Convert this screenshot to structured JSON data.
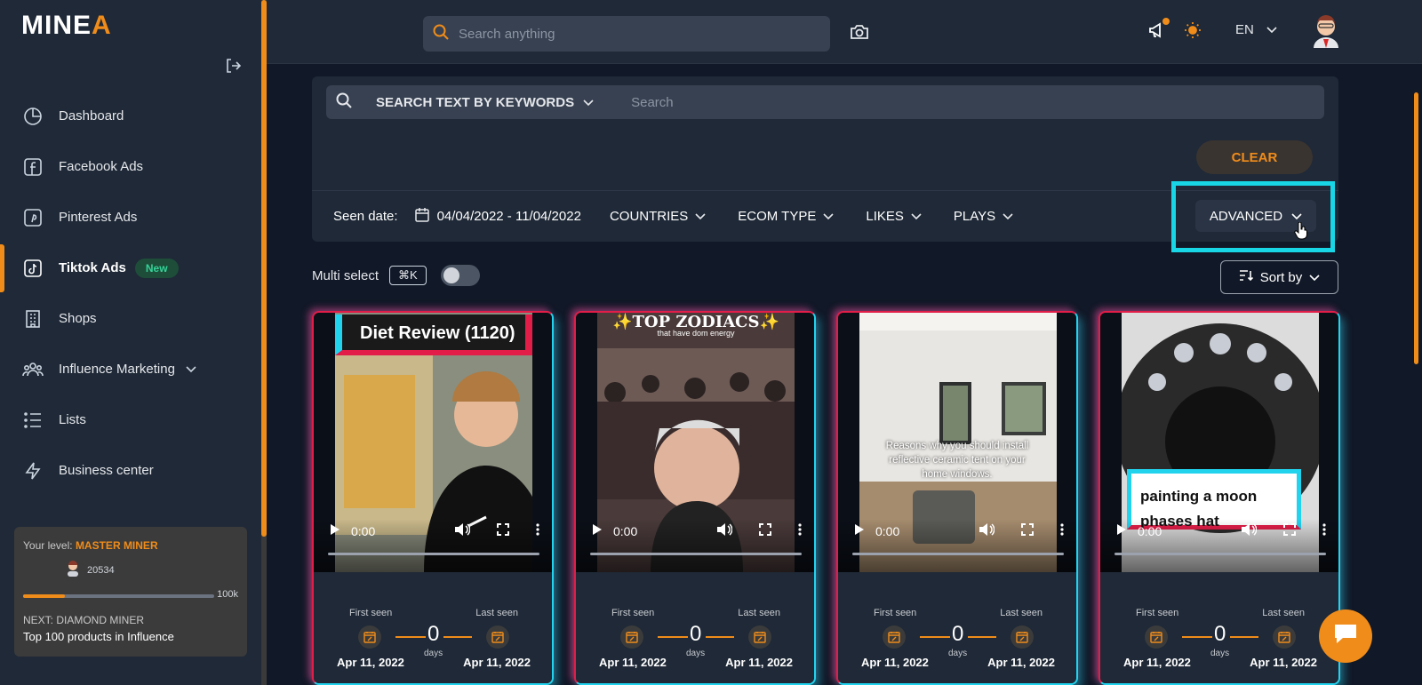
{
  "app": {
    "logo": "MINEA"
  },
  "sidebar": {
    "items": [
      {
        "label": "Dashboard",
        "icon": "dashboard-icon"
      },
      {
        "label": "Facebook Ads",
        "icon": "facebook-icon"
      },
      {
        "label": "Pinterest Ads",
        "icon": "pinterest-icon"
      },
      {
        "label": "Tiktok Ads",
        "icon": "tiktok-icon",
        "active": true,
        "badge": "New"
      },
      {
        "label": "Shops",
        "icon": "shop-icon"
      },
      {
        "label": "Influence Marketing",
        "icon": "users-icon"
      },
      {
        "label": "Lists",
        "icon": "list-icon"
      },
      {
        "label": "Business center",
        "icon": "bolt-icon"
      }
    ],
    "level": {
      "your_level_label": "Your level:",
      "your_level": "MASTER MINER",
      "points": "20534",
      "max": "100k",
      "progress_fraction": 0.22,
      "next_label": "NEXT: DIAMOND MINER",
      "next_text": "Top 100 products in Influence"
    }
  },
  "topbar": {
    "search_placeholder": "Search anything",
    "lang": "EN"
  },
  "filters": {
    "keyword_mode": "SEARCH TEXT BY KEYWORDS",
    "keyword_placeholder": "Search",
    "clear_label": "CLEAR",
    "seen_date_label": "Seen date:",
    "date_range": "04/04/2022 - 11/04/2022",
    "countries": "COUNTRIES",
    "ecom_type": "ECOM TYPE",
    "likes": "LIKES",
    "plays": "PLAYS",
    "advanced": "ADVANCED"
  },
  "toolbar": {
    "multi_select_label": "Multi select",
    "shortcut": "⌘K",
    "sort_label": "Sort by"
  },
  "cards": [
    {
      "caption": "Diet Review (1120)",
      "time": "0:00",
      "first_seen_label": "First seen",
      "last_seen_label": "Last seen",
      "days": "0",
      "days_label": "days",
      "first_date": "Apr 11, 2022",
      "last_date": "Apr 11, 2022"
    },
    {
      "caption": "✨TOP ZODIACS✨",
      "subcaption": "that have dom energy",
      "time": "0:00",
      "first_seen_label": "First seen",
      "last_seen_label": "Last seen",
      "days": "0",
      "days_label": "days",
      "first_date": "Apr 11, 2022",
      "last_date": "Apr 11, 2022"
    },
    {
      "caption": "Reasons why you should install reflective ceramic tent on your home windows.",
      "time": "0:00",
      "first_seen_label": "First seen",
      "last_seen_label": "Last seen",
      "days": "0",
      "days_label": "days",
      "first_date": "Apr 11, 2022",
      "last_date": "Apr 11, 2022"
    },
    {
      "caption": "painting a moon phases hat",
      "time": "0:00",
      "first_seen_label": "First seen",
      "last_seen_label": "Last seen",
      "days": "0",
      "days_label": "days",
      "first_date": "Apr 11, 2022",
      "last_date": "Apr 11, 2022"
    }
  ],
  "colors": {
    "accent": "#f08c1a",
    "highlight": "#19d6e6",
    "badge_green": "#34d399"
  }
}
